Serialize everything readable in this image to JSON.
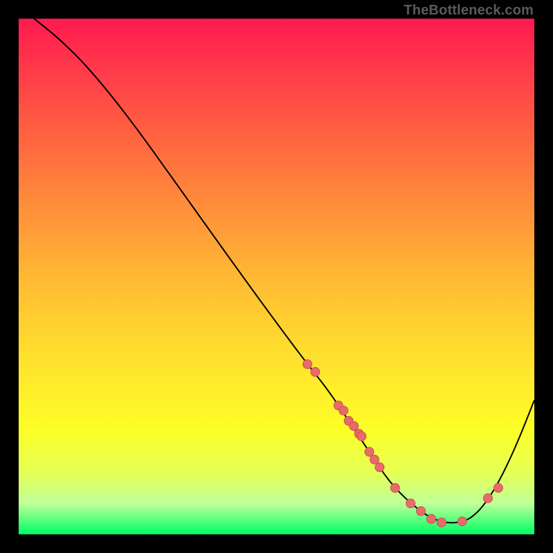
{
  "watermark": "TheBottleneck.com",
  "chart_data": {
    "type": "line",
    "title": "",
    "xlabel": "",
    "ylabel": "",
    "xlim": [
      0,
      100
    ],
    "ylim": [
      0,
      100
    ],
    "curve": {
      "name": "bottleneck-curve",
      "x": [
        3,
        8,
        14,
        22,
        32,
        42,
        50,
        56,
        60,
        64,
        68,
        72,
        76,
        80,
        84,
        88,
        92,
        96,
        100
      ],
      "y": [
        100,
        96,
        90,
        80,
        66,
        52,
        41,
        33,
        28,
        22,
        16,
        10,
        6,
        3,
        2,
        3,
        8,
        16,
        26
      ]
    },
    "series": [
      {
        "name": "dots",
        "x": [
          56,
          57.5,
          62,
          63,
          64,
          65,
          66,
          66.5,
          68,
          69,
          70,
          73,
          76,
          78,
          80,
          82,
          86,
          91,
          93
        ],
        "y": [
          33,
          31.5,
          25,
          24,
          22,
          21,
          19.5,
          19,
          16,
          14.5,
          13,
          9,
          6,
          4.5,
          3,
          2.3,
          2.5,
          7,
          9
        ]
      }
    ]
  }
}
